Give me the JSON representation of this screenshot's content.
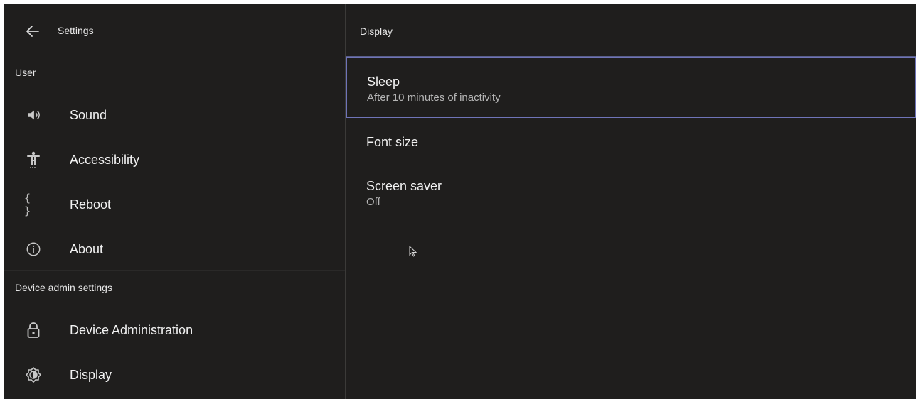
{
  "left": {
    "header_title": "Settings",
    "sections": [
      {
        "label": "User",
        "items": [
          {
            "label": "Sound",
            "icon": "speaker-icon"
          },
          {
            "label": "Accessibility",
            "icon": "accessibility-icon"
          },
          {
            "label": "Reboot",
            "icon": "braces-icon"
          },
          {
            "label": "About",
            "icon": "info-icon"
          }
        ]
      },
      {
        "label": "Device admin settings",
        "items": [
          {
            "label": "Device Administration",
            "icon": "lock-icon"
          },
          {
            "label": "Display",
            "icon": "brightness-icon"
          }
        ]
      }
    ]
  },
  "right": {
    "header_title": "Display",
    "settings": [
      {
        "title": "Sleep",
        "subtitle": "After 10 minutes of inactivity",
        "selected": true
      },
      {
        "title": "Font size",
        "subtitle": ""
      },
      {
        "title": "Screen saver",
        "subtitle": "Off"
      }
    ]
  },
  "colors": {
    "background": "#1f1e1d",
    "selection_border": "#6f74b8",
    "text_primary": "#f1f1f1",
    "text_secondary": "#b5b5b5"
  }
}
